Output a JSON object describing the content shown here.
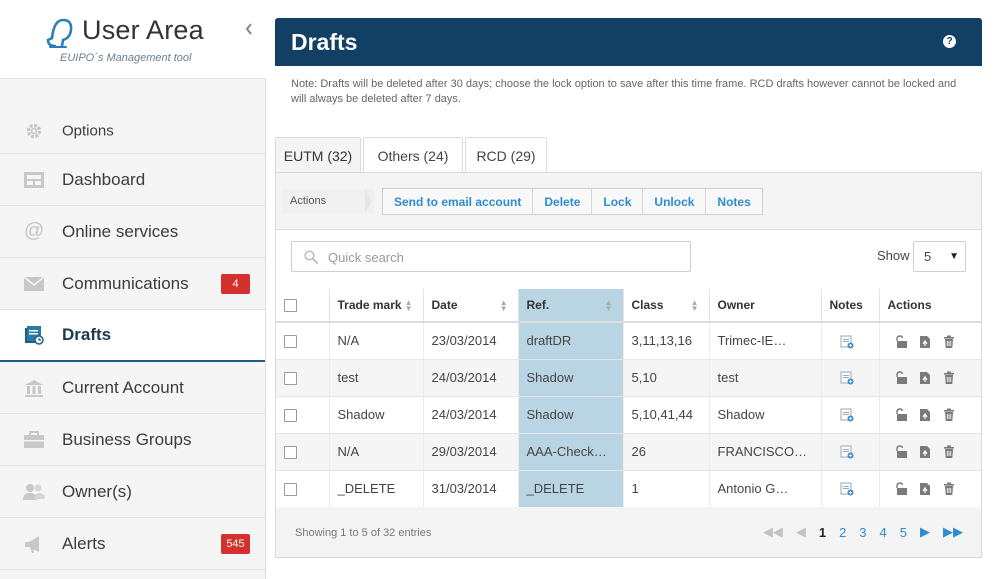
{
  "brand": {
    "title": "User Area",
    "subtitle": "EUIPO´s Management tool"
  },
  "sidebar": {
    "items": [
      {
        "label": "Options",
        "icon": "gear-icon"
      },
      {
        "label": "Dashboard",
        "icon": "dashboard-icon"
      },
      {
        "label": "Online services",
        "icon": "at-icon"
      },
      {
        "label": "Communications",
        "icon": "envelope-icon",
        "badge": "4"
      },
      {
        "label": "Drafts",
        "icon": "drafts-icon",
        "active": true
      },
      {
        "label": "Current Account",
        "icon": "bank-icon"
      },
      {
        "label": "Business Groups",
        "icon": "briefcase-icon"
      },
      {
        "label": "Owner(s)",
        "icon": "users-icon"
      },
      {
        "label": "Alerts",
        "icon": "megaphone-icon",
        "badge": "545"
      }
    ]
  },
  "header": {
    "title": "Drafts",
    "help": "?"
  },
  "note": "Note: Drafts will be deleted after 30 days; choose the lock option to save after this time frame. RCD drafts however cannot be locked and will always be deleted after 7 days.",
  "tabs": [
    {
      "label": "EUTM (32)",
      "active": true
    },
    {
      "label": "Others (24)"
    },
    {
      "label": "RCD (29)"
    }
  ],
  "actions": {
    "label": "Actions",
    "buttons": [
      "Send to email account",
      "Delete",
      "Lock",
      "Unlock",
      "Notes"
    ]
  },
  "search": {
    "placeholder": "Quick search",
    "value": ""
  },
  "show": {
    "label": "Show",
    "value": "5"
  },
  "table": {
    "columns": [
      "Trade mark",
      "Date",
      "Ref.",
      "Class",
      "Owner",
      "Notes",
      "Actions"
    ],
    "sorted_column": "Ref.",
    "rows": [
      {
        "trade_mark": "N/A",
        "date": "23/03/2014",
        "ref": "draftDR",
        "class": "3,11,13,16",
        "owner": "Trimec-IE…"
      },
      {
        "trade_mark": "test",
        "date": "24/03/2014",
        "ref": "Shadow",
        "class": "5,10",
        "owner": "test"
      },
      {
        "trade_mark": "Shadow",
        "date": "24/03/2014",
        "ref": "Shadow",
        "class": "5,10,41,44",
        "owner": "Shadow"
      },
      {
        "trade_mark": "N/A",
        "date": "29/03/2014",
        "ref": "AAA-Check…",
        "class": "26",
        "owner": "FRANCISCO…"
      },
      {
        "trade_mark": "_DELETE",
        "date": "31/03/2014",
        "ref": "_DELETE",
        "class": "1",
        "owner": "Antonio G…"
      }
    ]
  },
  "footer": {
    "entries": "Showing 1 to 5 of 32 entries",
    "pages": [
      "1",
      "2",
      "3",
      "4",
      "5"
    ],
    "current_page": "1"
  },
  "colors": {
    "header": "#123f64",
    "accent": "#2e8ccf",
    "badge": "#d3312d",
    "sorted_column": "#b9d5e4"
  }
}
